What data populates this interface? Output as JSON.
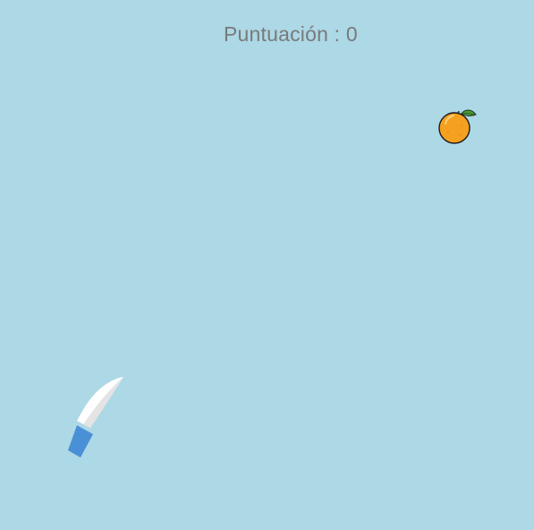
{
  "hud": {
    "score_label": "Puntuación : 0",
    "score": 0
  },
  "game": {
    "background_color": "#add8e6",
    "score_text_color": "#7a7a7a"
  },
  "fruits": [
    {
      "type": "orange",
      "icon": "orange-icon",
      "color": "#f5a020",
      "leaf_color": "#4a9a3a"
    }
  ],
  "knife": {
    "icon": "knife-icon",
    "blade_color": "#e8e8e8",
    "handle_color": "#4a90d6"
  }
}
